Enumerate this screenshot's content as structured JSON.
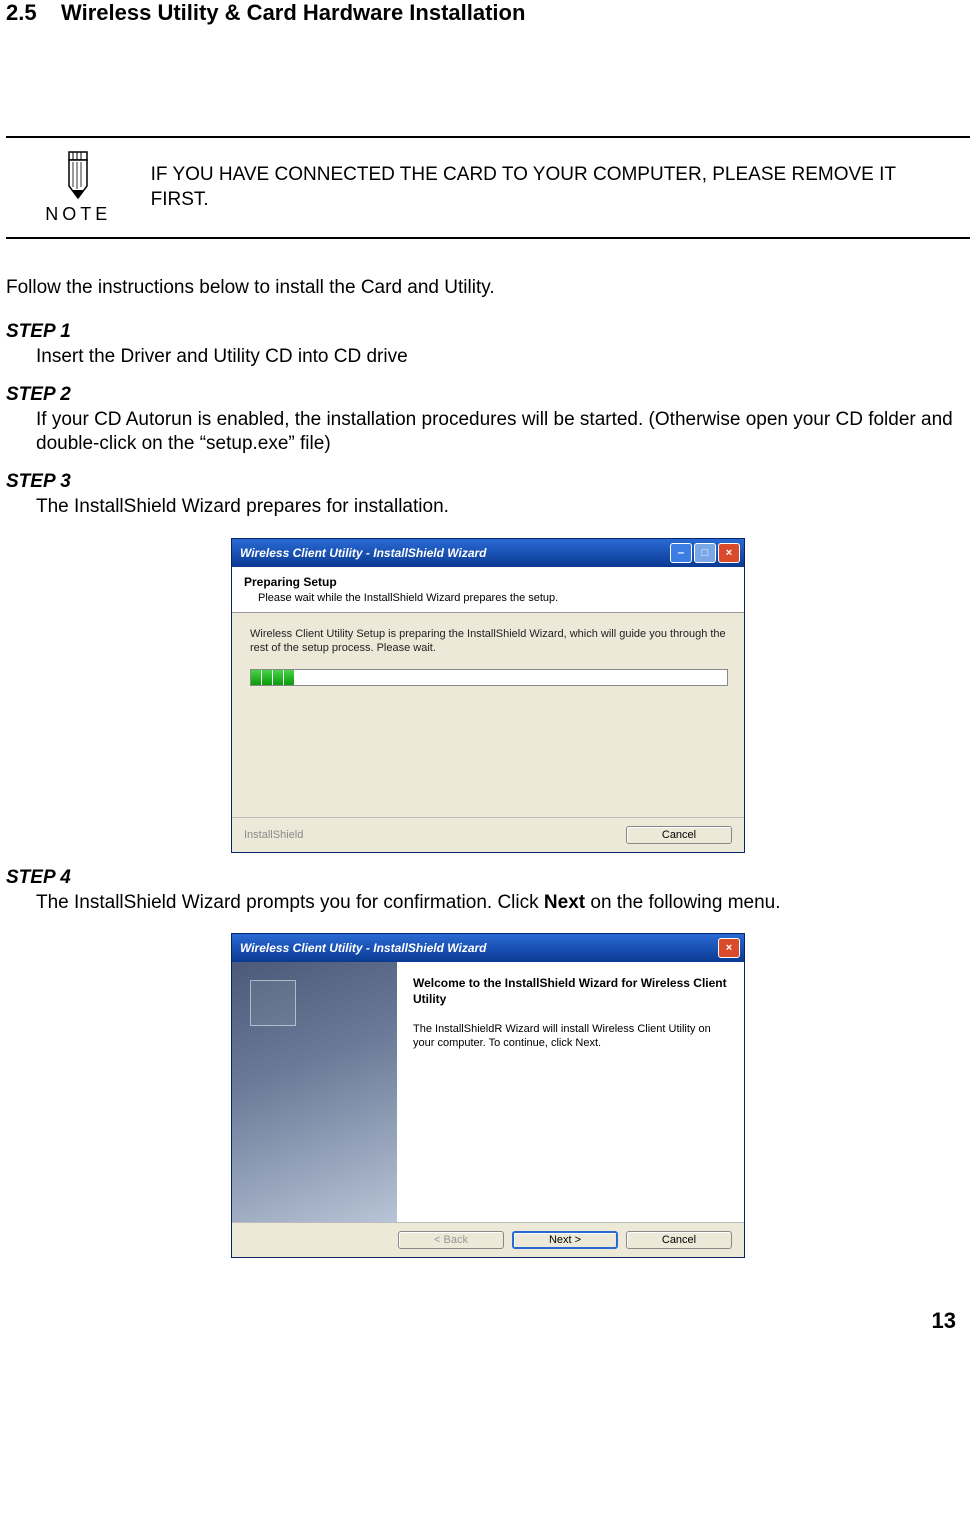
{
  "section": {
    "number": "2.5",
    "title": "Wireless Utility & Card Hardware Installation"
  },
  "note": {
    "label": "NOTE",
    "text": "IF YOU HAVE CONNECTED THE CARD TO YOUR COMPUTER, PLEASE REMOVE IT FIRST."
  },
  "intro": "Follow the instructions below to install the Card and Utility.",
  "steps": {
    "s1": {
      "heading": "STEP 1",
      "text": "Insert the Driver and Utility CD into CD drive"
    },
    "s2": {
      "heading": "STEP 2",
      "text": "If your CD Autorun is enabled, the installation procedures will be started. (Otherwise open your CD folder and double-click on the “setup.exe” file)"
    },
    "s3": {
      "heading": "STEP 3",
      "text": "The InstallShield Wizard prepares for installation."
    },
    "s4": {
      "heading": "STEP 4",
      "text_pre": "The InstallShield Wizard prompts you for confirmation. Click ",
      "text_bold": "Next",
      "text_post": " on the following menu."
    }
  },
  "dialog1": {
    "title": "Wireless Client Utility - InstallShield Wizard",
    "header_title": "Preparing Setup",
    "header_sub": "Please wait while the InstallShield Wizard prepares the setup.",
    "body": "Wireless Client Utility Setup is preparing the InstallShield Wizard, which will guide you through the rest of the setup process. Please wait.",
    "brand": "InstallShield",
    "cancel": "Cancel"
  },
  "dialog2": {
    "title": "Wireless Client Utility - InstallShield Wizard",
    "welcome_title": "Welcome to the InstallShield Wizard for Wireless Client Utility",
    "welcome_text": "The InstallShieldR Wizard will install Wireless Client Utility on your computer.  To continue, click Next.",
    "back": "< Back",
    "next": "Next >",
    "cancel": "Cancel"
  },
  "page_number": "13"
}
